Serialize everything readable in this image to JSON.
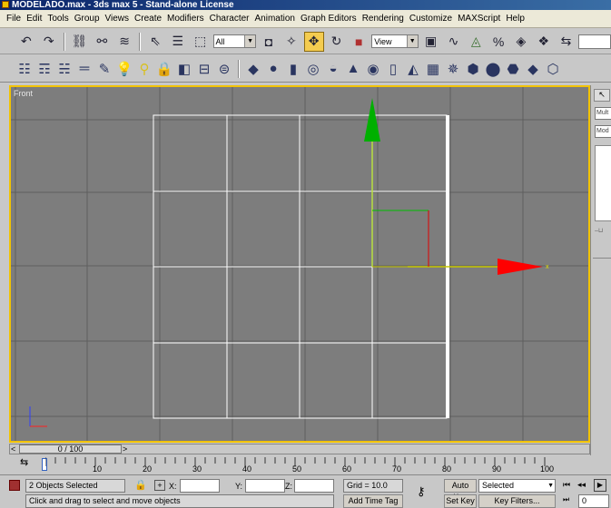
{
  "window": {
    "title": "MODELADO.max - 3ds max 5 - Stand-alone License"
  },
  "menu": [
    "File",
    "Edit",
    "Tools",
    "Group",
    "Views",
    "Create",
    "Modifiers",
    "Character",
    "Animation",
    "Graph Editors",
    "Rendering",
    "Customize",
    "MAXScript",
    "Help"
  ],
  "toolbar": {
    "selection_filter": "All",
    "ref_coord": "View"
  },
  "viewport": {
    "label": "Front",
    "gizmo_x_label": "x"
  },
  "side_panel": {
    "tab1": "Mult",
    "tab2": "Mod"
  },
  "timeline": {
    "slider_label": "0 / 100",
    "prev_glyph": "<",
    "next_glyph": ">",
    "ticks": [
      "10",
      "20",
      "30",
      "40",
      "50",
      "60",
      "70",
      "80",
      "90",
      "100"
    ]
  },
  "status": {
    "selection": "2 Objects Selected",
    "prompt": "Click and drag to select and move objects",
    "x_label": "X:",
    "y_label": "Y:",
    "z_label": "Z:",
    "x_value": "",
    "y_value": "",
    "z_value": "",
    "grid": "Grid = 10.0",
    "add_time_tag": "Add Time Tag",
    "auto_key": "Auto Key",
    "set_key": "Set Key",
    "key_mode": "Selected",
    "key_filters": "Key Filters...",
    "frame": "0"
  }
}
